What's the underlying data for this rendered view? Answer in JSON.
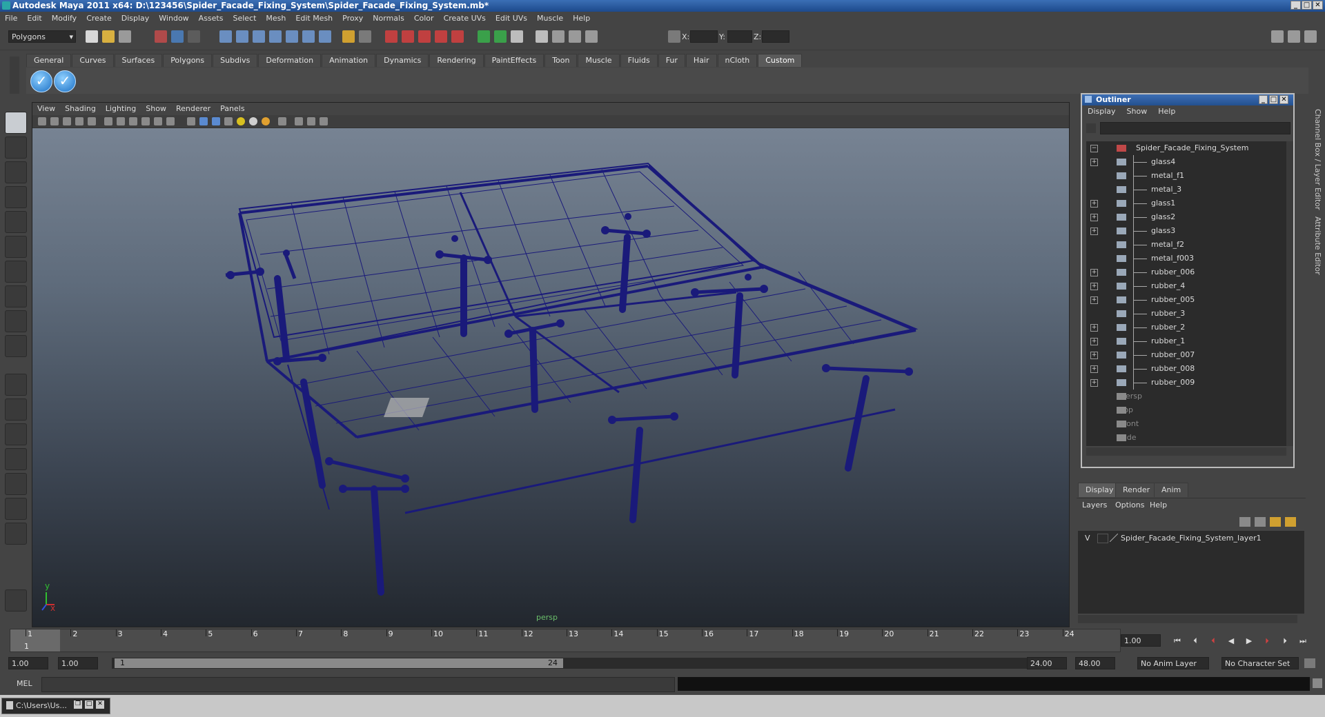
{
  "window": {
    "title": "Autodesk Maya 2011 x64: D:\\123456\\Spider_Facade_Fixing_System\\Spider_Facade_Fixing_System.mb*"
  },
  "menubar": [
    "File",
    "Edit",
    "Modify",
    "Create",
    "Display",
    "Window",
    "Assets",
    "Select",
    "Mesh",
    "Edit Mesh",
    "Proxy",
    "Normals",
    "Color",
    "Create UVs",
    "Edit UVs",
    "Muscle",
    "Help"
  ],
  "statusline": {
    "mode": "Polygons",
    "xyz": [
      "X:",
      "Y:",
      "Z:"
    ]
  },
  "shelf": {
    "tabs": [
      "General",
      "Curves",
      "Surfaces",
      "Polygons",
      "Subdivs",
      "Deformation",
      "Animation",
      "Dynamics",
      "Rendering",
      "PaintEffects",
      "Toon",
      "Muscle",
      "Fluids",
      "Fur",
      "Hair",
      "nCloth",
      "Custom"
    ],
    "active": "Custom",
    "check1": "✓",
    "check2": "✓"
  },
  "viewport": {
    "menu": [
      "View",
      "Shading",
      "Lighting",
      "Show",
      "Renderer",
      "Panels"
    ],
    "camera": "persp",
    "axis_y": "y",
    "axis_x": "x"
  },
  "outliner": {
    "title": "Outliner",
    "menu": [
      "Display",
      "Show",
      "Help"
    ],
    "items": [
      {
        "label": "Spider_Facade_Fixing_System",
        "expander": "−",
        "kind": "root"
      },
      {
        "label": "glass4",
        "expander": "+",
        "kind": "mesh"
      },
      {
        "label": "metal_f1",
        "expander": "",
        "kind": "mesh"
      },
      {
        "label": "metal_3",
        "expander": "",
        "kind": "mesh"
      },
      {
        "label": "glass1",
        "expander": "+",
        "kind": "mesh"
      },
      {
        "label": "glass2",
        "expander": "+",
        "kind": "mesh"
      },
      {
        "label": "glass3",
        "expander": "+",
        "kind": "mesh"
      },
      {
        "label": "metal_f2",
        "expander": "",
        "kind": "mesh"
      },
      {
        "label": "metal_f003",
        "expander": "",
        "kind": "mesh"
      },
      {
        "label": "rubber_006",
        "expander": "+",
        "kind": "mesh"
      },
      {
        "label": "rubber_4",
        "expander": "+",
        "kind": "mesh"
      },
      {
        "label": "rubber_005",
        "expander": "+",
        "kind": "mesh"
      },
      {
        "label": "rubber_3",
        "expander": "",
        "kind": "mesh"
      },
      {
        "label": "rubber_2",
        "expander": "+",
        "kind": "mesh"
      },
      {
        "label": "rubber_1",
        "expander": "+",
        "kind": "mesh"
      },
      {
        "label": "rubber_007",
        "expander": "+",
        "kind": "mesh"
      },
      {
        "label": "rubber_008",
        "expander": "+",
        "kind": "mesh"
      },
      {
        "label": "rubber_009",
        "expander": "+",
        "kind": "mesh"
      },
      {
        "label": "persp",
        "expander": "",
        "kind": "cam"
      },
      {
        "label": "top",
        "expander": "",
        "kind": "cam"
      },
      {
        "label": "front",
        "expander": "",
        "kind": "cam"
      },
      {
        "label": "side",
        "expander": "",
        "kind": "cam"
      }
    ]
  },
  "layers": {
    "tabs": [
      "Display",
      "Render",
      "Anim"
    ],
    "menu": [
      "Layers",
      "Options",
      "Help"
    ],
    "layer": {
      "visible": "V",
      "name": "Spider_Facade_Fixing_System_layer1"
    }
  },
  "sidestrip": {
    "label1": "Channel Box / Layer Editor",
    "label2": "Attribute Editor"
  },
  "timeline": {
    "ticks": [
      "1",
      "2",
      "3",
      "4",
      "5",
      "6",
      "7",
      "8",
      "9",
      "10",
      "11",
      "12",
      "13",
      "14",
      "15",
      "16",
      "17",
      "18",
      "19",
      "20",
      "21",
      "22",
      "23",
      "24"
    ],
    "current_frame_label": "1",
    "current_time": "1.00",
    "start": "1.00",
    "playback_start": "1.00",
    "range_start": "1",
    "range_end": "24",
    "playback_end": "24.00",
    "end": "48.00",
    "anim_layer": "No Anim Layer",
    "char_set": "No Character Set"
  },
  "cmdline": {
    "label": "MEL"
  },
  "taskbar": {
    "item": "C:\\Users\\Us..."
  },
  "colors": {
    "titlebar": "#23508f",
    "wireframe": "#1a1a7a",
    "camlabel": "#6bbf6b"
  }
}
